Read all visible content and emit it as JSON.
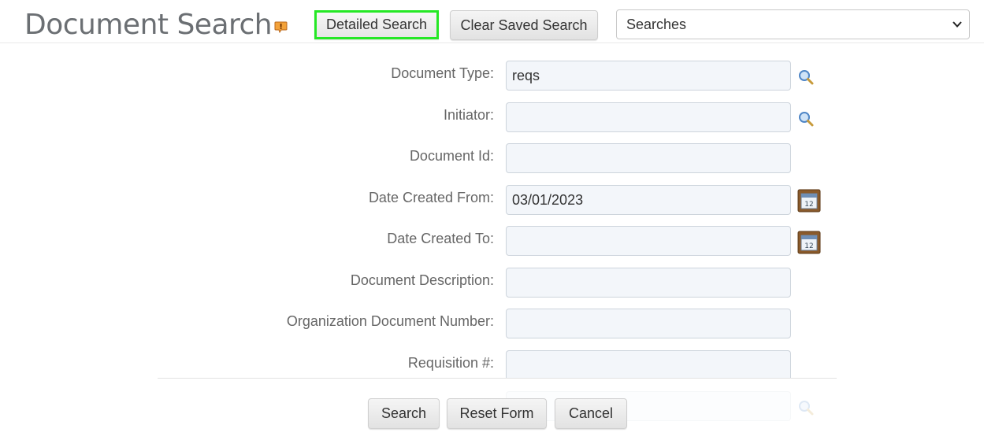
{
  "header": {
    "title": "Document Search",
    "detailed_search_label": "Detailed Search",
    "clear_saved_search_label": "Clear Saved Search",
    "searches_select": {
      "selected": "Searches"
    },
    "help_icon": "help-icon",
    "highlight_color": "#25e825"
  },
  "form": {
    "fields": [
      {
        "label": "Document Type:",
        "value": "reqs",
        "lookup": "magnifier-icon"
      },
      {
        "label": "Initiator:",
        "value": "",
        "lookup": "magnifier-icon"
      },
      {
        "label": "Document Id:",
        "value": ""
      },
      {
        "label": "Date Created From:",
        "value": "03/01/2023",
        "lookup": "calendar-icon"
      },
      {
        "label": "Date Created To:",
        "value": "",
        "lookup": "calendar-icon"
      },
      {
        "label": "Document Description:",
        "value": ""
      },
      {
        "label": "Organization Document Number:",
        "value": ""
      },
      {
        "label": "Requisition #:",
        "value": ""
      }
    ]
  },
  "footer": {
    "search_label": "Search",
    "reset_label": "Reset Form",
    "cancel_label": "Cancel"
  }
}
